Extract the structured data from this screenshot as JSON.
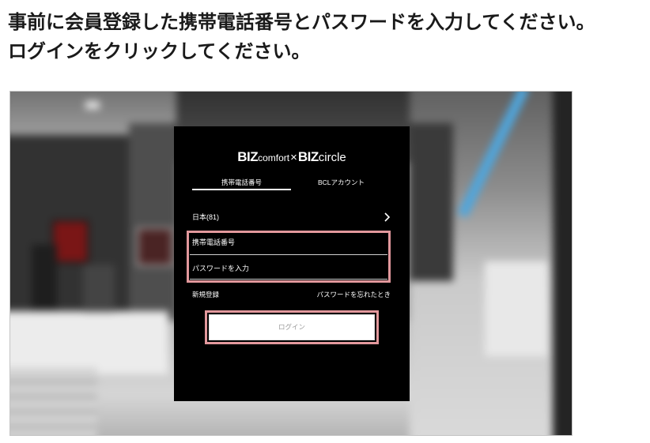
{
  "instructions": {
    "line1": "事前に会員登録した携帯電話番号とパスワードを入力してください。",
    "line2": "ログインをクリックしてください。"
  },
  "login_screen": {
    "logo": {
      "brand1_bold": "BIZ",
      "brand1_rest": "comfort",
      "separator": "×",
      "brand2_bold": "BIZ",
      "brand2_rest": "circle"
    },
    "tabs": [
      {
        "label": "携帯電話番号",
        "selected": true
      },
      {
        "label": "BCLアカウント",
        "selected": false
      }
    ],
    "country_code": {
      "value": "日本(81)",
      "icon": "chevron-right-icon"
    },
    "phone_field": {
      "placeholder": "携帯電話番号"
    },
    "password_field": {
      "placeholder": "パスワードを入力"
    },
    "register_link": "新規登録",
    "forgot_password_link": "パスワードを忘れたとき",
    "login_button": "ログイン"
  },
  "colors": {
    "panel_background": "#000000",
    "highlight_border": "#e2989c",
    "heading_text": "#1a1a1a"
  }
}
